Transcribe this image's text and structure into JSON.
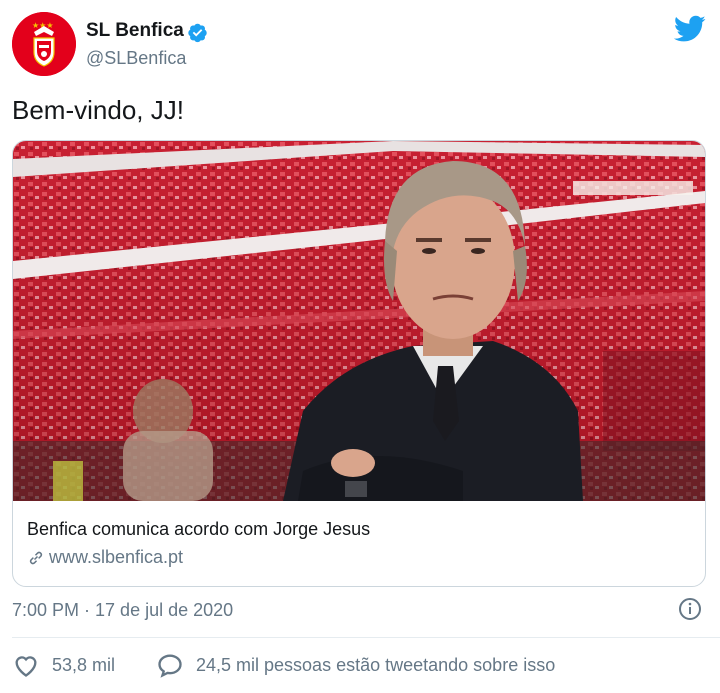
{
  "author": {
    "name": "SL Benfica",
    "handle": "@SLBenfica"
  },
  "tweet": {
    "text": "Bem-vindo, JJ!",
    "timestamp": "7:00 PM · 17 de jul de 2020"
  },
  "card": {
    "title": "Benfica comunica acordo com Jorge Jesus",
    "domain": "www.slbenfica.pt"
  },
  "stats": {
    "likes": "53,8 mil",
    "conversation": "24,5 mil pessoas estão tweetando sobre isso"
  },
  "colors": {
    "brand_blue": "#1da1f2",
    "benfica_red": "#e3001b",
    "secondary_text": "#657786"
  },
  "icons": [
    "benfica-crest-icon",
    "verified-badge-icon",
    "twitter-bird-icon",
    "link-icon",
    "info-icon",
    "heart-icon",
    "speech-bubble-icon"
  ]
}
